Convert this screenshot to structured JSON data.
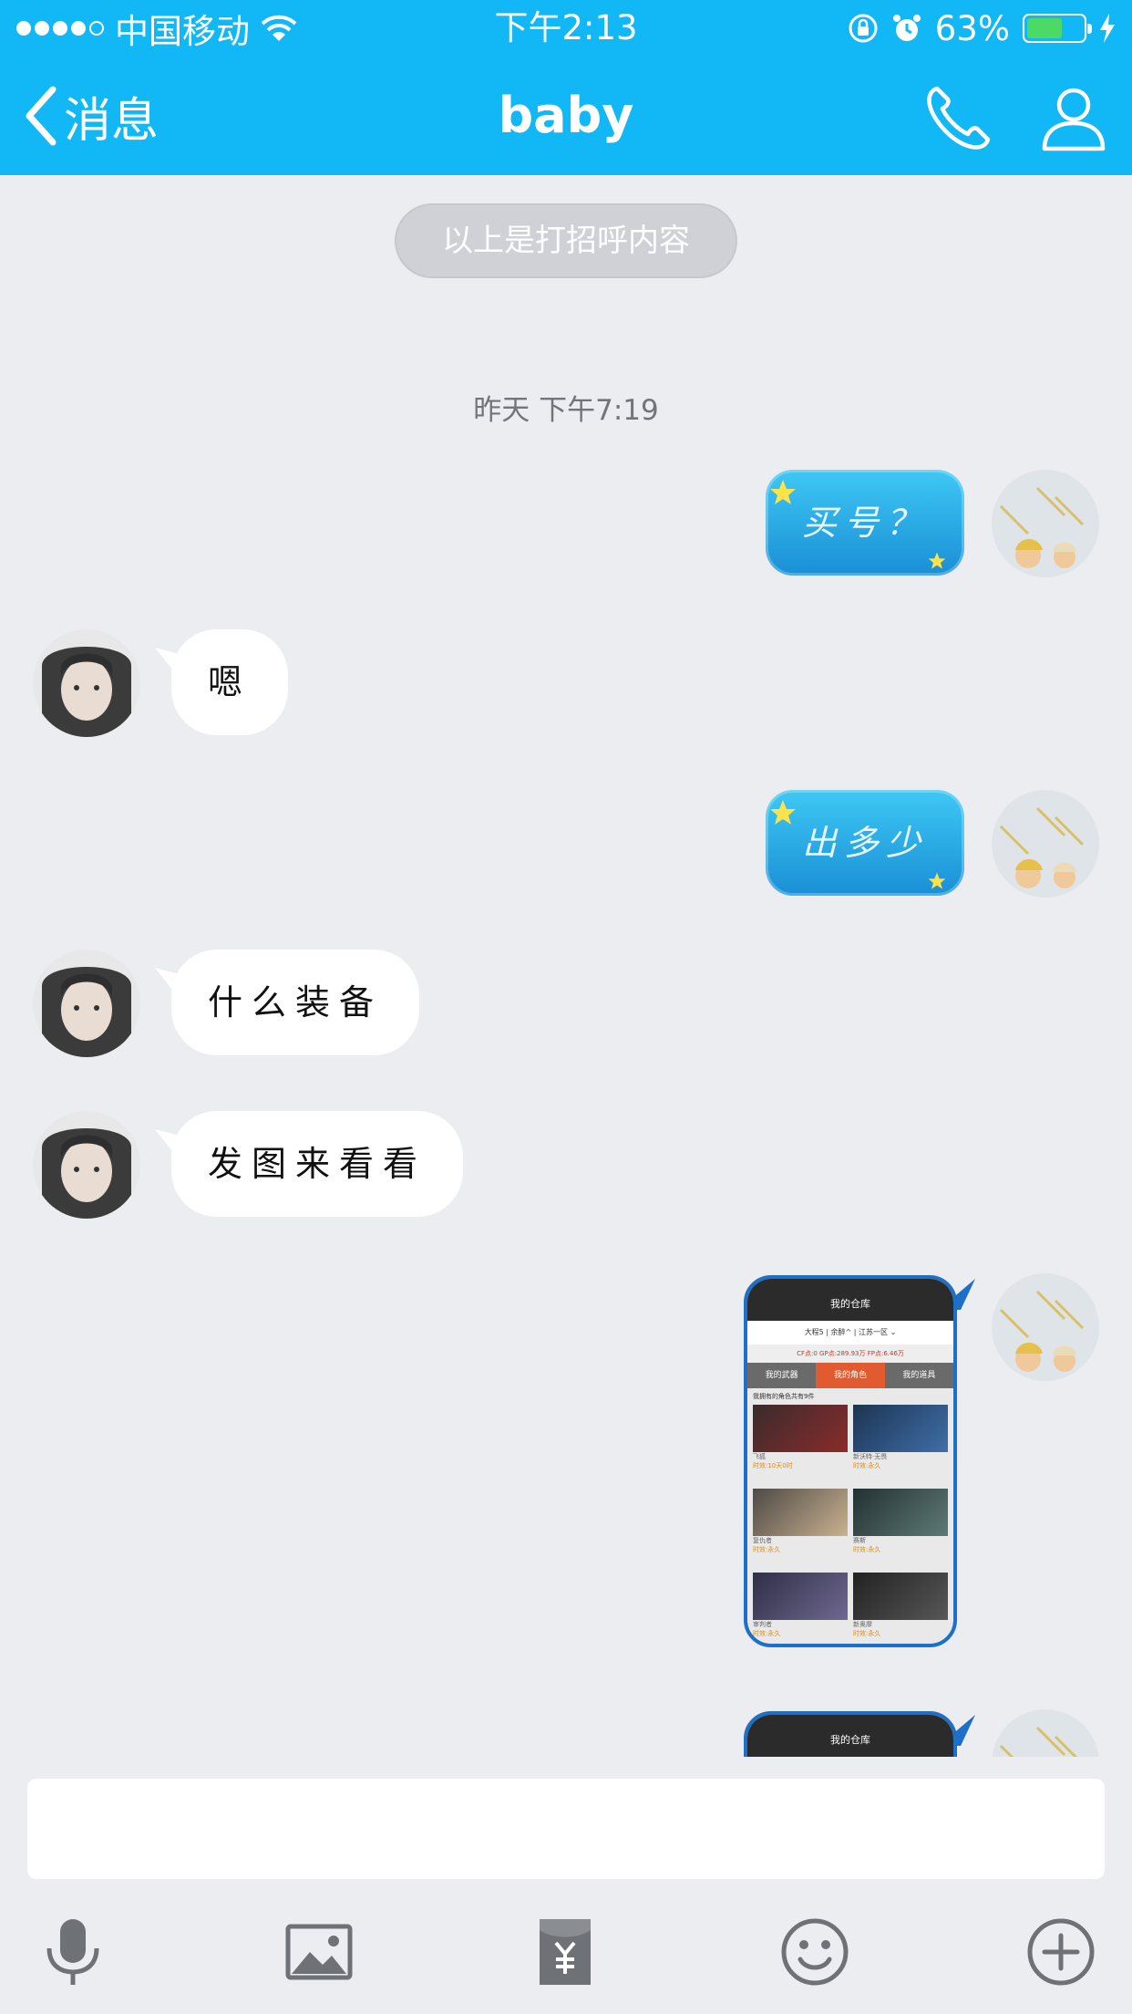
{
  "status_bar": {
    "carrier": "中国移动",
    "time": "下午2:13",
    "battery_percent": "63%",
    "battery_level": 0.63
  },
  "nav": {
    "back_label": "消息",
    "title": "baby",
    "icons": [
      "back-chevron-icon",
      "phone-icon",
      "profile-icon"
    ]
  },
  "chat": {
    "greeting_notice": "以上是打招呼内容",
    "timestamp": "昨天 下午7:19",
    "messages": [
      {
        "from": "me",
        "text": "买号？"
      },
      {
        "from": "them",
        "text": "嗯"
      },
      {
        "from": "me",
        "text": "出多少"
      },
      {
        "from": "them",
        "text": "什么装备"
      },
      {
        "from": "them",
        "text": "发图来看看"
      },
      {
        "from": "me",
        "type": "image"
      },
      {
        "from": "me",
        "type": "image"
      }
    ],
    "screenshot_preview": {
      "title": "我的仓库",
      "server": "大程5 | 余醉^ | 江苏一区 ⌄",
      "points": "CF点:0 GP点:289.93万 FP点:6.46万",
      "tabs": [
        "我的武器",
        "我的角色",
        "我的道具"
      ],
      "active_tab": "我的角色",
      "count_text": "我拥有的角色共有9件",
      "items": [
        {
          "name": "飞狐",
          "validity": "时效:10天0时"
        },
        {
          "name": "新沃特·无畏",
          "validity": "时效:永久"
        },
        {
          "name": "复仇者",
          "validity": "时效:永久"
        },
        {
          "name": "赛斯",
          "validity": "时效:永久"
        },
        {
          "name": "审判者",
          "validity": "时效:永久"
        },
        {
          "name": "新奥摩",
          "validity": "时效:永久"
        }
      ]
    }
  },
  "input": {
    "placeholder": "",
    "value": ""
  },
  "toolbar": {
    "icons": [
      "microphone-icon",
      "image-icon",
      "red-packet-icon",
      "emoji-icon",
      "plus-icon"
    ]
  },
  "colors": {
    "header_blue": "#12b7f5",
    "chat_bg": "#ebedf1",
    "bubble_blue": "#1a8fd6",
    "battery_green": "#4cd964"
  }
}
